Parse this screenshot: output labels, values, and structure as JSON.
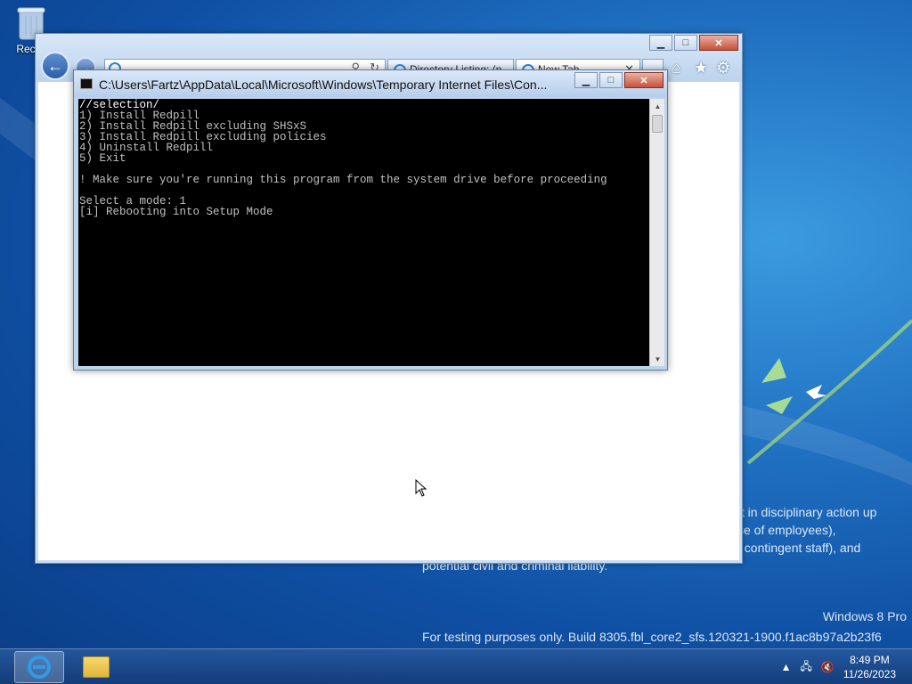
{
  "desktop": {
    "recycle_bin_label": "Recyc",
    "notice_lines": [
      "It in disciplinary action up",
      "se of employees),",
      "f contingent staff), and",
      "potential civil and criminal liability."
    ],
    "edition": "Windows 8 Pro",
    "build": "For testing purposes only. Build 8305.fbl_core2_sfs.120321-1900.f1ac8b97a2b23f6"
  },
  "ie": {
    "tabs": [
      {
        "label": "Directory Listing: (n"
      },
      {
        "label": "New Tab"
      }
    ],
    "tab_close": "✕",
    "toolbar_icons": [
      "home-icon",
      "favorites-icon",
      "tools-icon"
    ]
  },
  "console": {
    "title": "C:\\Users\\Fartz\\AppData\\Local\\Microsoft\\Windows\\Temporary Internet Files\\Con...",
    "lines": [
      "//selection/",
      "1) Install Redpill",
      "2) Install Redpill excluding SHSxS",
      "3) Install Redpill excluding policies",
      "4) Uninstall Redpill",
      "5) Exit",
      "",
      "! Make sure you're running this program from the system drive before proceeding",
      "",
      "Select a mode: 1",
      "[i] Rebooting into Setup Mode"
    ]
  },
  "taskbar": {
    "time": "8:49 PM",
    "date": "11/26/2023"
  }
}
